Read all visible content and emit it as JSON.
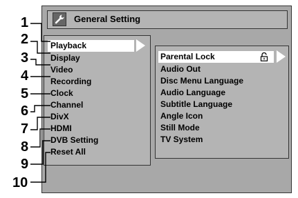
{
  "window": {
    "title": "General Setting",
    "title_icon": "wrench-icon"
  },
  "left_menu": {
    "items": [
      {
        "label": "Playback",
        "selected": true
      },
      {
        "label": "Display",
        "selected": false
      },
      {
        "label": "Video",
        "selected": false
      },
      {
        "label": "Recording",
        "selected": false
      },
      {
        "label": "Clock",
        "selected": false
      },
      {
        "label": "Channel",
        "selected": false
      },
      {
        "label": "DivX",
        "selected": false
      },
      {
        "label": "HDMI",
        "selected": false
      },
      {
        "label": "DVB Setting",
        "selected": false
      },
      {
        "label": "Reset All",
        "selected": false
      }
    ]
  },
  "submenu": {
    "items": [
      {
        "label": "Parental Lock",
        "selected": true,
        "icon": "lock-icon"
      },
      {
        "label": "Audio Out"
      },
      {
        "label": "Disc Menu Language"
      },
      {
        "label": "Audio Language"
      },
      {
        "label": "Subtitle Language"
      },
      {
        "label": "Angle Icon"
      },
      {
        "label": "Still Mode"
      },
      {
        "label": "TV System"
      }
    ]
  },
  "callouts": [
    "1",
    "2",
    "3",
    "4",
    "5",
    "6",
    "7",
    "8",
    "9",
    "10"
  ],
  "colors": {
    "panel": "#b4b4b4",
    "frame": "#a8a8a8",
    "highlight": "#ffffff",
    "text": "#000000"
  }
}
